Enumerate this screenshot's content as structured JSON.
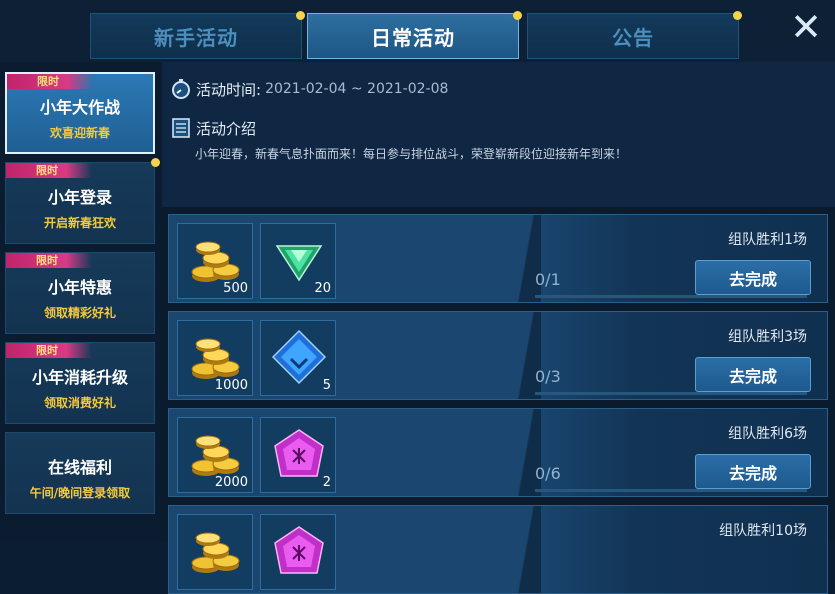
{
  "tabs": [
    {
      "label": "新手活动",
      "active": false,
      "has_dot": true
    },
    {
      "label": "日常活动",
      "active": true,
      "has_dot": true
    },
    {
      "label": "公告",
      "active": false,
      "has_dot": true
    }
  ],
  "close_icon": "close-icon",
  "sidebar": {
    "items": [
      {
        "flag": "限时",
        "title": "小年大作战",
        "sub": "欢喜迎新春",
        "active": true,
        "has_dot": false
      },
      {
        "flag": "限时",
        "title": "小年登录",
        "sub": "开启新春狂欢",
        "active": false,
        "has_dot": true
      },
      {
        "flag": "限时",
        "title": "小年特惠",
        "sub": "领取精彩好礼",
        "active": false,
        "has_dot": false
      },
      {
        "flag": "限时",
        "title": "小年消耗升级",
        "sub": "领取消费好礼",
        "active": false,
        "has_dot": false
      },
      {
        "flag": "",
        "title": "在线福利",
        "sub": "午间/晚间登录领取",
        "active": false,
        "has_dot": false
      }
    ]
  },
  "info": {
    "time_label": "活动时间:",
    "time_value": "2021-02-04 ~ 2021-02-08",
    "intro_label": "活动介绍",
    "intro_text": "小年迎春，新春气息扑面而来！每日参与排位战斗，荣登崭新段位迎接新年到来！"
  },
  "tasks": [
    {
      "condition": "组队胜利1场",
      "progress": "0/1",
      "fraction": 0,
      "button": "去完成",
      "rewards": [
        {
          "icon": "gold-coins-icon",
          "count": "500"
        },
        {
          "icon": "green-gem-icon",
          "count": "20"
        }
      ]
    },
    {
      "condition": "组队胜利3场",
      "progress": "0/3",
      "fraction": 0,
      "button": "去完成",
      "rewards": [
        {
          "icon": "gold-coins-icon",
          "count": "1000"
        },
        {
          "icon": "blue-crystal-icon",
          "count": "5"
        }
      ]
    },
    {
      "condition": "组队胜利6场",
      "progress": "0/6",
      "fraction": 0,
      "button": "去完成",
      "rewards": [
        {
          "icon": "gold-coins-icon",
          "count": "2000"
        },
        {
          "icon": "purple-gem-icon",
          "count": "2"
        }
      ]
    },
    {
      "condition": "组队胜利10场",
      "progress": "",
      "fraction": 0,
      "button": "",
      "rewards": [
        {
          "icon": "gold-coins-icon",
          "count": ""
        },
        {
          "icon": "purple-gem-icon",
          "count": ""
        }
      ]
    }
  ]
}
